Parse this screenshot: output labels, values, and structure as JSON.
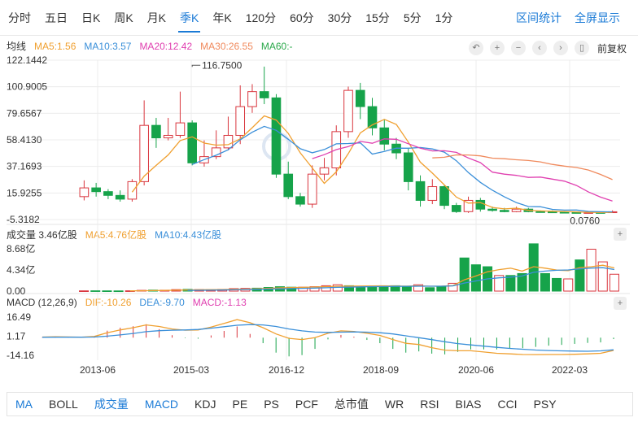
{
  "period_tabs": [
    {
      "label": "分时",
      "active": false
    },
    {
      "label": "五日",
      "active": false
    },
    {
      "label": "日K",
      "active": false
    },
    {
      "label": "周K",
      "active": false
    },
    {
      "label": "月K",
      "active": false
    },
    {
      "label": "季K",
      "active": true
    },
    {
      "label": "年K",
      "active": false
    },
    {
      "label": "120分",
      "active": false
    },
    {
      "label": "60分",
      "active": false
    },
    {
      "label": "30分",
      "active": false
    },
    {
      "label": "15分",
      "active": false
    },
    {
      "label": "5分",
      "active": false
    },
    {
      "label": "1分",
      "active": false
    }
  ],
  "right_links": {
    "stats": "区间统计",
    "fullscreen": "全屏显示"
  },
  "ma_legend": {
    "title": "均线",
    "items": [
      {
        "label": "MA5:1.56",
        "color": "#f0a030"
      },
      {
        "label": "MA10:3.57",
        "color": "#3a8fd9"
      },
      {
        "label": "MA20:12.42",
        "color": "#e040b0"
      },
      {
        "label": "MA30:26.55",
        "color": "#f08a5d"
      },
      {
        "label": "MA60:-",
        "color": "#2aa84a"
      }
    ]
  },
  "toolbar": {
    "icons": [
      "undo-icon",
      "zoom-in-icon",
      "zoom-out-icon",
      "scroll-left-icon",
      "scroll-right-icon",
      "adjust-icon"
    ],
    "glyphs": [
      "↶",
      "+",
      "−",
      "‹",
      "›",
      "▯"
    ],
    "fq_label": "前复权"
  },
  "vol_legend": {
    "title": "成交量 3.46亿股",
    "items": [
      {
        "label": "MA5:4.76亿股",
        "color": "#f0a030"
      },
      {
        "label": "MA10:4.43亿股",
        "color": "#3a8fd9"
      }
    ]
  },
  "macd_legend": {
    "title": "MACD (12,26,9)",
    "items": [
      {
        "label": "DIF:-10.26",
        "color": "#f0a030"
      },
      {
        "label": "DEA:-9.70",
        "color": "#3a8fd9"
      },
      {
        "label": "MACD:-1.13",
        "color": "#e040b0"
      }
    ]
  },
  "collapse_glyph": "+",
  "indicator_tabs": [
    {
      "label": "MA",
      "active": true
    },
    {
      "label": "BOLL",
      "active": false
    },
    {
      "label": "成交量",
      "active": true
    },
    {
      "label": "MACD",
      "active": true
    },
    {
      "label": "KDJ",
      "active": false
    },
    {
      "label": "PE",
      "active": false
    },
    {
      "label": "PS",
      "active": false
    },
    {
      "label": "PCF",
      "active": false
    },
    {
      "label": "总市值",
      "active": false
    },
    {
      "label": "WR",
      "active": false
    },
    {
      "label": "RSI",
      "active": false
    },
    {
      "label": "BIAS",
      "active": false
    },
    {
      "label": "CCI",
      "active": false
    },
    {
      "label": "PSY",
      "active": false
    }
  ],
  "colors": {
    "up": "#d9363e",
    "down": "#16a34a",
    "grid": "#ececec"
  },
  "chart_data": [
    {
      "type": "candlestick",
      "name": "price",
      "y_ticks": [
        "122.1442",
        "100.9005",
        "79.6567",
        "58.4130",
        "37.1693",
        "15.9255",
        "-5.3182"
      ],
      "ylim": [
        -5.3182,
        122.1442
      ],
      "x_tick_labels": [
        "2013-06",
        "2015-03",
        "2016-12",
        "2018-09",
        "2020-06",
        "2022-03"
      ],
      "annotations": [
        {
          "label": "116.7500",
          "value": 116.75,
          "candle": 9
        },
        {
          "label": "0.0760",
          "value": 0.076,
          "candle": 41
        }
      ],
      "candles": [
        {
          "o": 13,
          "c": 20,
          "h": 26,
          "l": 10
        },
        {
          "o": 20,
          "c": 17,
          "h": 24,
          "l": 13
        },
        {
          "o": 17,
          "c": 14,
          "h": 19,
          "l": 11
        },
        {
          "o": 14,
          "c": 11,
          "h": 18,
          "l": 9
        },
        {
          "o": 11,
          "c": 25,
          "h": 27,
          "l": 9
        },
        {
          "o": 25,
          "c": 70,
          "h": 90,
          "l": 22
        },
        {
          "o": 70,
          "c": 60,
          "h": 76,
          "l": 52
        },
        {
          "o": 60,
          "c": 62,
          "h": 76,
          "l": 58
        },
        {
          "o": 62,
          "c": 72,
          "h": 97,
          "l": 60
        },
        {
          "o": 72,
          "c": 40,
          "h": 74,
          "l": 38
        },
        {
          "o": 40,
          "c": 45,
          "h": 58,
          "l": 37
        },
        {
          "o": 45,
          "c": 52,
          "h": 66,
          "l": 43
        },
        {
          "o": 52,
          "c": 62,
          "h": 77,
          "l": 50
        },
        {
          "o": 62,
          "c": 85,
          "h": 102,
          "l": 55
        },
        {
          "o": 85,
          "c": 97,
          "h": 103,
          "l": 80
        },
        {
          "o": 97,
          "c": 92,
          "h": 117,
          "l": 87
        },
        {
          "o": 92,
          "c": 31,
          "h": 95,
          "l": 28
        },
        {
          "o": 31,
          "c": 13,
          "h": 41,
          "l": 11
        },
        {
          "o": 13,
          "c": 7,
          "h": 16,
          "l": 5
        },
        {
          "o": 7,
          "c": 31,
          "h": 38,
          "l": 4
        },
        {
          "o": 31,
          "c": 36,
          "h": 44,
          "l": 26
        },
        {
          "o": 36,
          "c": 65,
          "h": 70,
          "l": 30
        },
        {
          "o": 65,
          "c": 98,
          "h": 101,
          "l": 60
        },
        {
          "o": 98,
          "c": 85,
          "h": 104,
          "l": 75
        },
        {
          "o": 85,
          "c": 68,
          "h": 92,
          "l": 62
        },
        {
          "o": 68,
          "c": 55,
          "h": 75,
          "l": 50
        },
        {
          "o": 55,
          "c": 48,
          "h": 60,
          "l": 43
        },
        {
          "o": 48,
          "c": 25,
          "h": 52,
          "l": 18
        },
        {
          "o": 25,
          "c": 10,
          "h": 30,
          "l": 5
        },
        {
          "o": 10,
          "c": 21,
          "h": 27,
          "l": 7
        },
        {
          "o": 21,
          "c": 6,
          "h": 22,
          "l": 3
        },
        {
          "o": 6,
          "c": 1,
          "h": 8,
          "l": 0
        },
        {
          "o": 1,
          "c": 10,
          "h": 13,
          "l": 0
        },
        {
          "o": 10,
          "c": 3,
          "h": 12,
          "l": 1
        },
        {
          "o": 3,
          "c": 2,
          "h": 5,
          "l": 1
        },
        {
          "o": 2,
          "c": 1,
          "h": 4,
          "l": 0.5
        },
        {
          "o": 1,
          "c": 3,
          "h": 5,
          "l": 0.5
        },
        {
          "o": 3,
          "c": 1,
          "h": 4,
          "l": 0.5
        },
        {
          "o": 1,
          "c": 0.8,
          "h": 2,
          "l": 0.3
        },
        {
          "o": 0.8,
          "c": 0.5,
          "h": 2,
          "l": 0.2
        },
        {
          "o": 0.5,
          "c": 0.3,
          "h": 1.5,
          "l": 0.1
        },
        {
          "o": 0.3,
          "c": 0.2,
          "h": 1,
          "l": 0.076
        },
        {
          "o": 0.2,
          "c": 0.3,
          "h": 1,
          "l": 0.1
        },
        {
          "o": 0.3,
          "c": 0.2,
          "h": 0.8,
          "l": 0.1
        },
        {
          "o": 0.2,
          "c": 0.9,
          "h": 2,
          "l": 0.1
        }
      ],
      "series": [
        {
          "name": "MA5",
          "color": "#f0a030",
          "values": [
            null,
            null,
            null,
            null,
            16.6,
            29.4,
            38.0,
            46.4,
            57.8,
            60.8,
            55.8,
            54.2,
            54.6,
            59.2,
            68.2,
            77.6,
            74.2,
            63.6,
            48.0,
            36.0,
            23.6,
            32.8,
            47.4,
            64.0,
            70.4,
            74.8,
            70.8,
            56.6,
            40.6,
            31.8,
            22.4,
            12.6,
            7.8,
            8.2,
            4.4,
            3.2,
            3.8,
            2.0,
            1.6,
            1.3,
            1.1,
            0.8,
            0.5,
            0.3,
            0.4
          ]
        },
        {
          "name": "MA10",
          "color": "#3a8fd9",
          "values": [
            null,
            null,
            null,
            null,
            null,
            null,
            null,
            null,
            null,
            38.7,
            42.6,
            46.1,
            50.5,
            58.5,
            64.5,
            69.2,
            66.0,
            58.9,
            51.3,
            48.1,
            50.7,
            55.2,
            55.5,
            56.0,
            47.0,
            49.2,
            51.8,
            51.7,
            52.3,
            51.1,
            48.6,
            41.7,
            32.2,
            24.4,
            18.1,
            12.8,
            8.2,
            5.1,
            4.9,
            2.8,
            2.2,
            2.3,
            1.2,
            0.9,
            0.8
          ]
        },
        {
          "name": "MA20",
          "color": "#e040b0",
          "values": [
            null,
            null,
            null,
            null,
            null,
            null,
            null,
            null,
            null,
            null,
            null,
            null,
            null,
            null,
            null,
            null,
            null,
            null,
            null,
            43.4,
            46.6,
            50.6,
            53.0,
            57.2,
            55.7,
            59.2,
            58.9,
            55.3,
            51.8,
            49.6,
            49.7,
            48.4,
            43.9,
            40.2,
            32.6,
            31.0,
            30.0,
            28.4,
            28.6,
            27.0,
            25.4,
            21.9,
            16.7,
            12.6,
            9.5
          ]
        },
        {
          "name": "MA30",
          "color": "#f08a5d",
          "values": [
            null,
            null,
            null,
            null,
            null,
            null,
            null,
            null,
            null,
            null,
            null,
            null,
            null,
            null,
            null,
            null,
            null,
            null,
            null,
            null,
            null,
            null,
            null,
            null,
            null,
            null,
            null,
            null,
            null,
            44.0,
            44.5,
            46.4,
            46.3,
            45.6,
            43.8,
            43.3,
            42.5,
            41.9,
            40.8,
            38.8,
            37.4,
            36.3,
            34.3,
            30.8,
            26.6
          ]
        }
      ]
    },
    {
      "type": "bar",
      "name": "volume",
      "unit": "亿股",
      "y_ticks": [
        "8.68亿",
        "4.34亿",
        "0.00"
      ],
      "ylim": [
        0,
        8.68
      ],
      "values": [
        0.05,
        0.06,
        0.05,
        0.04,
        0.06,
        0.15,
        0.2,
        0.18,
        0.3,
        0.35,
        0.3,
        0.28,
        0.35,
        0.5,
        0.55,
        0.6,
        0.75,
        0.9,
        0.8,
        0.8,
        0.9,
        1.1,
        1.3,
        1.1,
        1.0,
        1.0,
        1.0,
        1.1,
        1.0,
        1.3,
        0.7,
        1.0,
        1.6,
        6.8,
        5.4,
        5.0,
        3.2,
        3.2,
        3.6,
        9.7,
        3.6,
        2.6,
        2.5,
        6.4,
        8.6,
        6.0,
        3.46
      ],
      "series": [
        {
          "name": "MA5",
          "color": "#f0a030",
          "values": [
            null,
            null,
            null,
            null,
            0.05,
            0.07,
            0.1,
            0.13,
            0.18,
            0.24,
            0.27,
            0.28,
            0.32,
            0.36,
            0.4,
            0.46,
            0.55,
            0.66,
            0.72,
            0.77,
            0.84,
            0.92,
            0.98,
            1.02,
            1.04,
            1.06,
            1.08,
            1.04,
            1.02,
            1.08,
            1.0,
            1.02,
            1.12,
            2.32,
            3.1,
            3.96,
            4.4,
            4.7,
            4.1,
            5.0,
            4.7,
            4.3,
            4.2,
            4.8,
            5.0,
            5.3,
            4.76
          ]
        },
        {
          "name": "MA10",
          "color": "#3a8fd9",
          "values": [
            null,
            null,
            null,
            null,
            null,
            null,
            null,
            null,
            null,
            0.14,
            0.16,
            0.19,
            0.22,
            0.27,
            0.32,
            0.37,
            0.41,
            0.47,
            0.52,
            0.56,
            0.62,
            0.69,
            0.76,
            0.82,
            0.87,
            0.91,
            0.94,
            0.96,
            0.98,
            1.0,
            1.0,
            1.0,
            1.06,
            1.66,
            2.08,
            2.5,
            2.72,
            2.86,
            3.1,
            3.86,
            4.11,
            4.27,
            4.34,
            4.56,
            4.73,
            4.8,
            4.43
          ]
        }
      ]
    },
    {
      "type": "line",
      "name": "MACD",
      "y_ticks": [
        "16.49",
        "1.17",
        "-14.16"
      ],
      "ylim": [
        -14.16,
        16.49
      ],
      "series": [
        {
          "name": "DIF",
          "color": "#f0a030",
          "values": [
            0.5,
            0.8,
            0.6,
            0.4,
            1.0,
            4.0,
            6.2,
            8.0,
            10.2,
            9.0,
            7.0,
            6.0,
            6.2,
            8.5,
            11.5,
            14.5,
            12.0,
            8.0,
            3.0,
            -0.5,
            -1.5,
            0.0,
            3.5,
            5.5,
            5.0,
            3.5,
            1.8,
            -1.5,
            -4.5,
            -5.5,
            -8.0,
            -10.0,
            -10.5,
            -10.5,
            -11.5,
            -12.5,
            -13.0,
            -13.5,
            -13.6,
            -13.5,
            -13.5,
            -13.3,
            -13.0,
            -12.5,
            -10.26
          ]
        },
        {
          "name": "DEA",
          "color": "#3a8fd9",
          "values": [
            0.3,
            0.4,
            0.4,
            0.4,
            0.5,
            1.2,
            2.2,
            3.4,
            4.8,
            5.6,
            6.0,
            6.2,
            6.6,
            7.6,
            8.8,
            10.0,
            10.5,
            10.2,
            9.0,
            7.0,
            5.5,
            4.5,
            4.2,
            4.4,
            4.6,
            4.4,
            4.0,
            3.0,
            1.5,
            0.0,
            -1.6,
            -3.3,
            -4.8,
            -5.8,
            -6.8,
            -7.8,
            -8.6,
            -9.3,
            -9.9,
            -10.3,
            -10.6,
            -10.8,
            -10.9,
            -10.6,
            -9.7
          ]
        },
        {
          "name": "MACD",
          "color": "#e040b0",
          "values": [
            0.4,
            0.8,
            0.4,
            0.0,
            1.0,
            5.6,
            8.0,
            9.2,
            10.8,
            6.8,
            2.0,
            -0.4,
            -0.8,
            1.8,
            5.4,
            9.0,
            3.0,
            -4.4,
            -12.0,
            -15.0,
            -14.0,
            -9.0,
            -1.4,
            2.2,
            0.8,
            -1.8,
            -4.4,
            -9.0,
            -12.0,
            -11.0,
            -12.8,
            -13.4,
            -11.4,
            -9.4,
            -9.4,
            -9.4,
            -8.8,
            -8.4,
            -7.4,
            -6.4,
            -5.8,
            -5.0,
            -4.2,
            -3.8,
            -1.13
          ]
        }
      ]
    }
  ]
}
